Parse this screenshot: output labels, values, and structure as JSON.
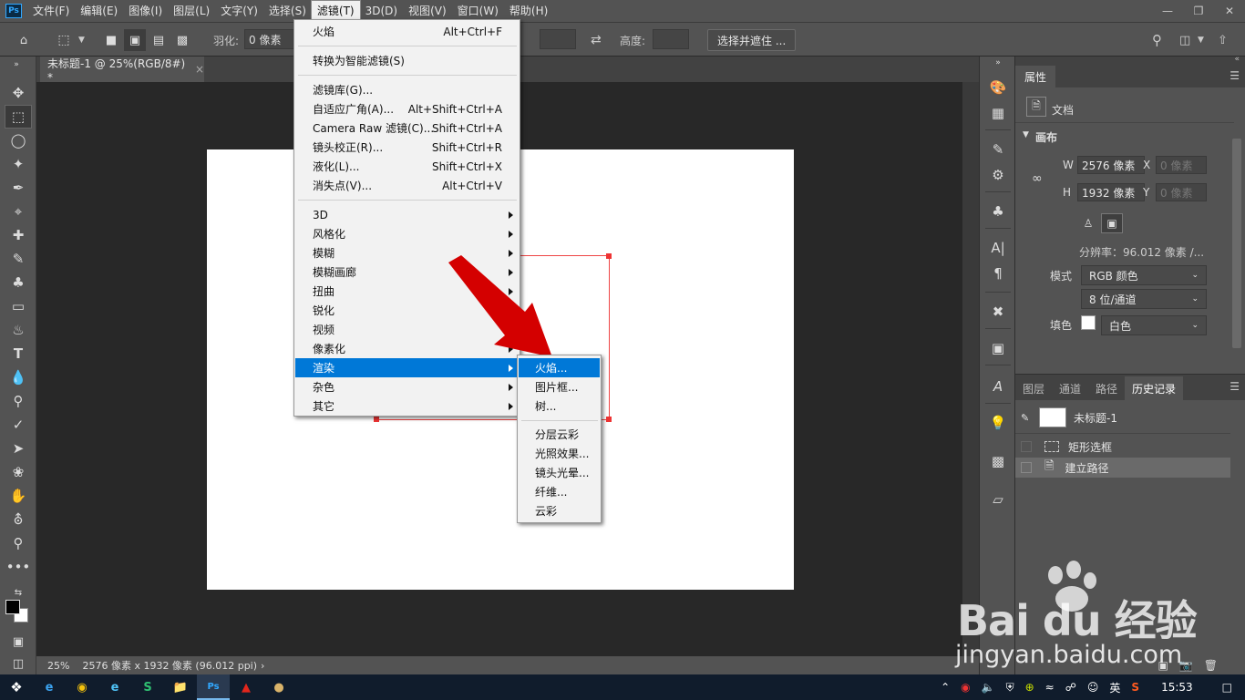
{
  "menubar": {
    "items": [
      "文件(F)",
      "编辑(E)",
      "图像(I)",
      "图层(L)",
      "文字(Y)",
      "选择(S)",
      "滤镜(T)",
      "3D(D)",
      "视图(V)",
      "窗口(W)",
      "帮助(H)"
    ],
    "active_index": 6
  },
  "optbar": {
    "feather_label": "羽化:",
    "feather_value": "0 像素",
    "height_label": "高度:",
    "select_mask_button": "选择并遮住 ..."
  },
  "doc": {
    "tab_title": "未标题-1 @ 25%(RGB/8#) *",
    "close": "×"
  },
  "status": {
    "zoom": "25%",
    "info": "2576 像素 x 1932 像素 (96.012 ppi)"
  },
  "filter_menu": {
    "items": [
      {
        "label": "火焰",
        "shortcut": "Alt+Ctrl+F"
      },
      {
        "label": "转换为智能滤镜(S)",
        "shortcut": ""
      },
      {
        "label": "滤镜库(G)...",
        "shortcut": ""
      },
      {
        "label": "自适应广角(A)...",
        "shortcut": "Alt+Shift+Ctrl+A"
      },
      {
        "label": "Camera Raw 滤镜(C)...",
        "shortcut": "Shift+Ctrl+A"
      },
      {
        "label": "镜头校正(R)...",
        "shortcut": "Shift+Ctrl+R"
      },
      {
        "label": "液化(L)...",
        "shortcut": "Shift+Ctrl+X"
      },
      {
        "label": "消失点(V)...",
        "shortcut": "Alt+Ctrl+V"
      },
      {
        "label": "3D",
        "shortcut": ""
      },
      {
        "label": "风格化",
        "shortcut": ""
      },
      {
        "label": "模糊",
        "shortcut": ""
      },
      {
        "label": "模糊画廊",
        "shortcut": ""
      },
      {
        "label": "扭曲",
        "shortcut": ""
      },
      {
        "label": "锐化",
        "shortcut": ""
      },
      {
        "label": "视频",
        "shortcut": ""
      },
      {
        "label": "像素化",
        "shortcut": ""
      },
      {
        "label": "渲染",
        "shortcut": ""
      },
      {
        "label": "杂色",
        "shortcut": ""
      },
      {
        "label": "其它",
        "shortcut": ""
      }
    ]
  },
  "render_submenu": {
    "items": [
      "火焰...",
      "图片框...",
      "树...",
      "分层云彩",
      "光照效果...",
      "镜头光晕...",
      "纤维...",
      "云彩"
    ]
  },
  "properties": {
    "tab": "属性",
    "doc_label": "文档",
    "canvas_section": "画布",
    "w_label": "W",
    "w_value": "2576 像素",
    "x_label": "X",
    "x_placeholder": "0 像素",
    "h_label": "H",
    "h_value": "1932 像素",
    "y_label": "Y",
    "y_placeholder": "0 像素",
    "resolution": "分辨率：96.012 像素 /...",
    "mode_label": "模式",
    "mode_value": "RGB 颜色",
    "depth_value": "8 位/通道",
    "fill_label": "填色",
    "fill_value": "白色"
  },
  "history_panel": {
    "tabs": [
      "图层",
      "通道",
      "路径",
      "历史记录"
    ],
    "active_tab": 3,
    "snapshot": "未标题-1",
    "rows": [
      "矩形选框",
      "建立路径"
    ]
  },
  "taskbar": {
    "ime": "英",
    "clock": "15:53"
  },
  "watermark": {
    "brand": "Bai du 经验",
    "url": "jingyan.baidu.com"
  },
  "colors": {
    "accent": "#0078d7",
    "selection": "#e33333",
    "arrow": "#d40000"
  }
}
